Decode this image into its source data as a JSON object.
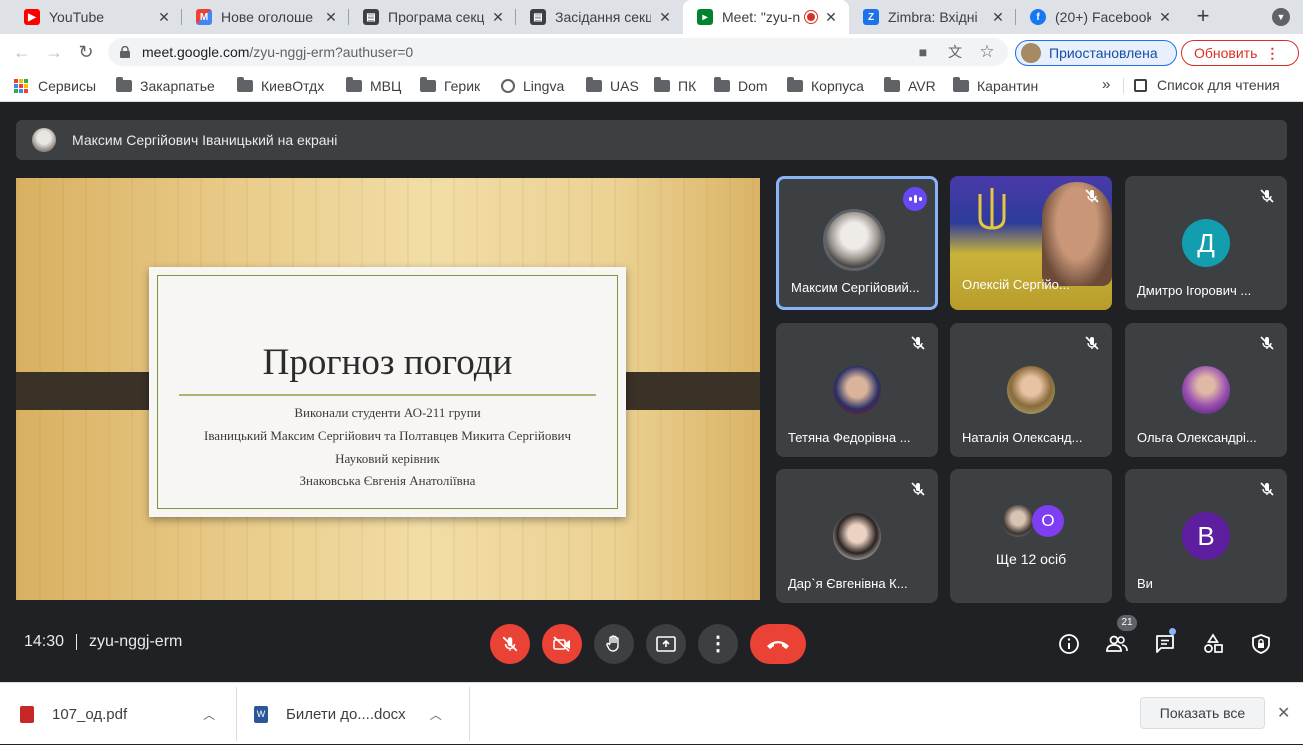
{
  "tabs": [
    {
      "label": "YouTube",
      "icon": "youtube-icon",
      "color": "#ff0000"
    },
    {
      "label": "Нове оголоше",
      "icon": "gmail-icon",
      "color": "#ea4335"
    },
    {
      "label": "Програма секц",
      "icon": "doc-icon",
      "color": "#3c4043"
    },
    {
      "label": "Засідання секц",
      "icon": "doc-icon",
      "color": "#3c4043"
    },
    {
      "label": "Meet: \"zyu-n",
      "icon": "meet-icon",
      "color": "#00832d"
    },
    {
      "label": "Zimbra: Вхідні",
      "icon": "zimbra-icon",
      "color": "#1a73e8"
    },
    {
      "label": "(20+) Facebook",
      "icon": "facebook-icon",
      "color": "#1877f2"
    }
  ],
  "omnibar": {
    "url_host": "meet.google.com",
    "url_path": "/zyu-nggj-erm?authuser=0",
    "profile_label": "Приостановлена",
    "update_label": "Обновить"
  },
  "bookmarks": [
    {
      "label": "Сервисы",
      "icon": "apps-grid-icon"
    },
    {
      "label": "Закарпатье",
      "icon": "folder-icon"
    },
    {
      "label": "КиевОтдх",
      "icon": "folder-icon"
    },
    {
      "label": "МВЦ",
      "icon": "folder-icon"
    },
    {
      "label": "Герик",
      "icon": "folder-icon"
    },
    {
      "label": "Lingva",
      "icon": "globe-icon"
    },
    {
      "label": "UAS",
      "icon": "folder-icon"
    },
    {
      "label": "ПК",
      "icon": "folder-icon"
    },
    {
      "label": "Dom",
      "icon": "folder-icon"
    },
    {
      "label": "Корпуса",
      "icon": "folder-icon"
    },
    {
      "label": "AVR",
      "icon": "folder-icon"
    },
    {
      "label": "Карантин",
      "icon": "folder-icon"
    }
  ],
  "bookmarks_more": "»",
  "reading_list": "Список для чтения",
  "meet": {
    "presenter_banner": "Максим Сергійович Іваницький на екрані",
    "slide": {
      "title": "Прогноз погоди",
      "lines": [
        "Виконали студенти АО-211 групи",
        "Іваницький Максим Сергійович та Полтавцев Микита Сергійович",
        "Науковий керівник",
        "Знаковська Євгенія Анатоліївна"
      ]
    },
    "participants": [
      {
        "name": "Максим Сергійовий...",
        "avatar": "photo",
        "speaking": true,
        "muted": false
      },
      {
        "name": "Олексій Сергійо...",
        "avatar": "video",
        "speaking": false,
        "muted": true
      },
      {
        "name": "Дмитро Ігорович ...",
        "avatar": "letter",
        "letter": "Д",
        "color": "#129eaf",
        "muted": true
      },
      {
        "name": "Тетяна Федорівна ...",
        "avatar": "photo",
        "muted": true
      },
      {
        "name": "Наталія Олександ...",
        "avatar": "photo",
        "muted": true
      },
      {
        "name": "Ольга Олександрі...",
        "avatar": "photo",
        "muted": true
      },
      {
        "name": "Дар`я Євгенівна К...",
        "avatar": "photo",
        "muted": true
      },
      {
        "name": "Ще 12 осіб",
        "avatar": "group",
        "letter": "О",
        "color": "#7e3ff2"
      },
      {
        "name": "Ви",
        "avatar": "letter",
        "letter": "В",
        "color": "#6a1b9a",
        "muted": true
      }
    ],
    "clock": "14:30",
    "meeting_code": "zyu-nggj-erm",
    "participant_count": "21"
  },
  "downloads": [
    {
      "name": "107_од.pdf",
      "icon": "pdf-icon"
    },
    {
      "name": "Билети до....docx",
      "icon": "word-icon"
    }
  ],
  "show_all": "Показать все"
}
